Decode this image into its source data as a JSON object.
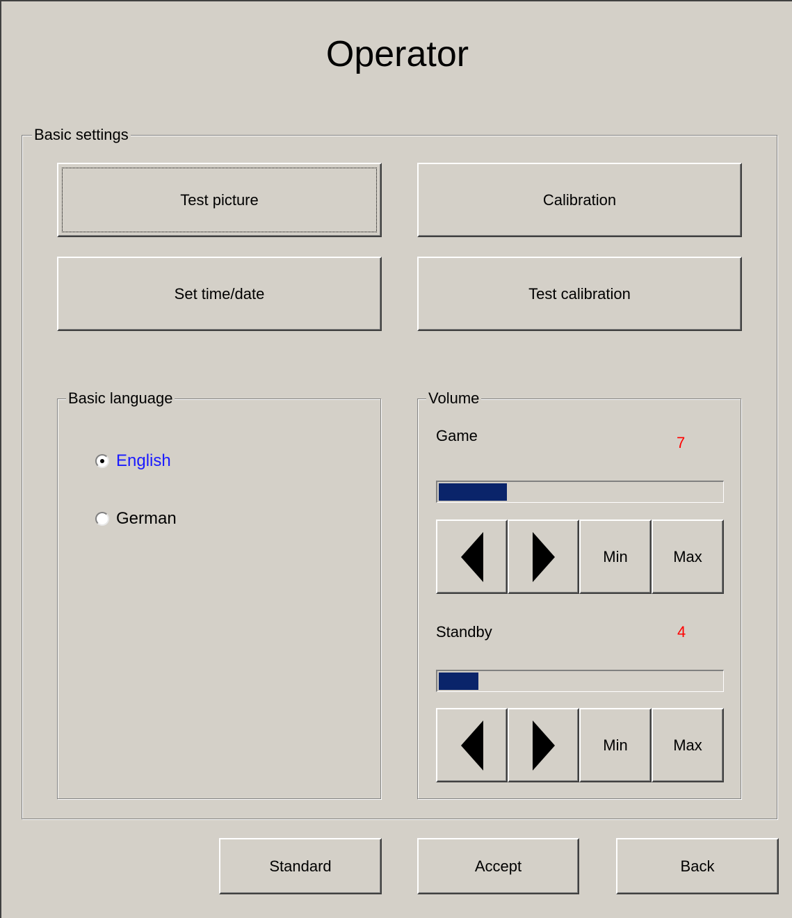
{
  "window": {
    "title": "Operator"
  },
  "basic_settings": {
    "label": "Basic settings",
    "buttons": {
      "test_picture": "Test picture",
      "calibration": "Calibration",
      "set_time_date": "Set time/date",
      "test_calibration": "Test calibration"
    }
  },
  "basic_language": {
    "label": "Basic language",
    "options": [
      {
        "label": "English",
        "selected": true
      },
      {
        "label": "German",
        "selected": false
      }
    ]
  },
  "volume": {
    "label": "Volume",
    "game": {
      "label": "Game",
      "value": "7",
      "level_fraction": 0.24,
      "min_label": "Min",
      "max_label": "Max"
    },
    "standby": {
      "label": "Standby",
      "value": "4",
      "level_fraction": 0.14,
      "min_label": "Min",
      "max_label": "Max"
    }
  },
  "footer": {
    "standard": "Standard",
    "accept": "Accept",
    "back": "Back"
  },
  "colors": {
    "background": "#d4d0c8",
    "selected_text": "#1a1aff",
    "value_text": "#ff0000",
    "level_fill": "#0a246a"
  },
  "icons": {
    "decrease": "triangle-left-icon",
    "increase": "triangle-right-icon"
  }
}
